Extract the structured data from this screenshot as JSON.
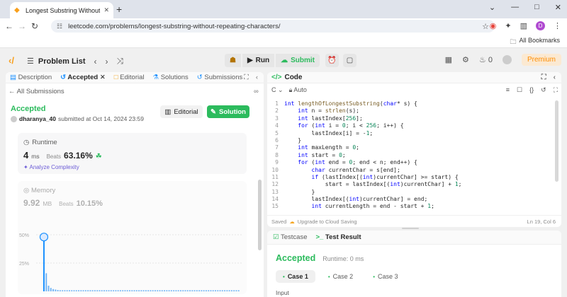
{
  "browser": {
    "tab_title": "Longest Substring Without Rep",
    "url": "leetcode.com/problems/longest-substring-without-repeating-characters/",
    "bookmarks_label": "All Bookmarks",
    "profile_initial": "D"
  },
  "header": {
    "problem_list": "Problem List",
    "run": "Run",
    "submit": "Submit",
    "streak": "0",
    "premium": "Premium"
  },
  "left": {
    "tabs": [
      "Description",
      "Accepted",
      "Editorial",
      "Solutions",
      "Submissions"
    ],
    "all_submissions": "All Submissions",
    "status": "Accepted",
    "user": "dharanya_40",
    "submitted": "submitted at Oct 14, 2024 23:59",
    "editorial_btn": "Editorial",
    "solution_btn": "Solution",
    "runtime": {
      "label": "Runtime",
      "value": "4",
      "unit": "ms",
      "beats_label": "Beats",
      "beats": "63.16%",
      "analyze": "Analyze Complexity"
    },
    "memory": {
      "label": "Memory",
      "value": "9.92",
      "unit": "MB",
      "beats_label": "Beats",
      "beats": "10.15%"
    }
  },
  "chart_data": {
    "type": "bar",
    "yticks": [
      "50%",
      "25%"
    ],
    "ylim": [
      0,
      55
    ],
    "values": [
      48,
      16,
      5,
      3,
      2,
      1.6,
      1.2,
      1,
      1,
      1,
      1,
      1,
      1,
      1,
      1,
      1,
      1,
      1,
      1,
      1,
      1,
      1,
      1,
      1,
      1,
      1,
      1,
      1,
      1,
      1,
      1,
      1,
      1,
      1,
      1,
      1,
      1,
      1,
      1,
      1,
      1,
      1,
      1,
      1,
      1,
      1,
      1,
      1,
      1,
      1,
      1,
      1,
      1,
      1,
      1,
      1,
      1,
      1,
      1,
      1,
      1,
      1,
      1,
      1,
      1,
      1,
      1,
      1,
      1,
      1,
      1,
      1,
      1,
      1,
      1,
      1,
      1,
      1,
      1,
      1,
      1,
      1,
      1,
      1,
      1
    ],
    "highlight_index": 0
  },
  "code": {
    "title": "Code",
    "lang": "C",
    "mode": "Auto",
    "lines": [
      "int lengthOfLongestSubstring(char* s) {",
      "    int n = strlen(s);",
      "    int lastIndex[256];",
      "    for (int i = 0; i < 256; i++) {",
      "        lastIndex[i] = -1;",
      "    }",
      "    int maxLength = 0;",
      "    int start = 0;",
      "    for (int end = 0; end < n; end++) {",
      "        char currentChar = s[end];",
      "        if (lastIndex[(int)currentChar] >= start) {",
      "            start = lastIndex[(int)currentChar] + 1;",
      "        }",
      "        lastIndex[(int)currentChar] = end;",
      "        int currentLength = end - start + 1;"
    ],
    "saved": "Saved",
    "upgrade": "Upgrade to Cloud Saving",
    "cursor": "Ln 19, Col 6"
  },
  "result": {
    "testcase_tab": "Testcase",
    "result_tab": "Test Result",
    "status": "Accepted",
    "runtime": "Runtime: 0 ms",
    "cases": [
      "Case 1",
      "Case 2",
      "Case 3"
    ],
    "input_label": "Input"
  }
}
